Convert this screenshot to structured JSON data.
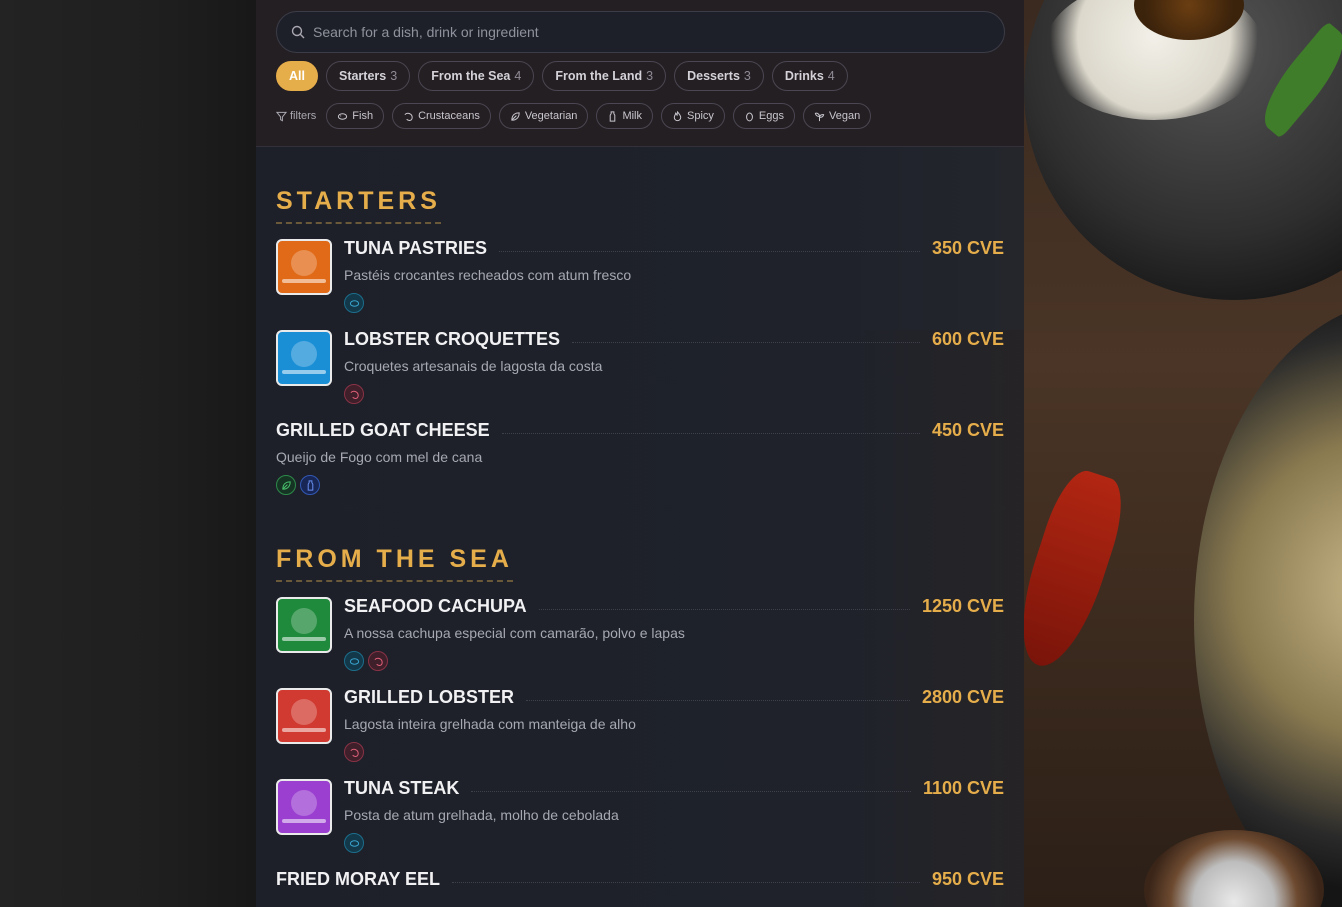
{
  "search": {
    "placeholder": "Search for a dish, drink or ingredient"
  },
  "tabs": [
    {
      "label": "All",
      "count": ""
    },
    {
      "label": "Starters",
      "count": "3"
    },
    {
      "label": "From the Sea",
      "count": "4"
    },
    {
      "label": "From the Land",
      "count": "3"
    },
    {
      "label": "Desserts",
      "count": "3"
    },
    {
      "label": "Drinks",
      "count": "4"
    }
  ],
  "filters": {
    "label": "filters",
    "chips": [
      "Fish",
      "Crustaceans",
      "Vegetarian",
      "Milk",
      "Spicy",
      "Eggs",
      "Vegan"
    ]
  },
  "colors": {
    "accent": "#e6ad4b",
    "panel": "#1f222b",
    "fish": "#1c6e8c",
    "crustaceans": "#8a3246",
    "vegetarian": "#2d8a4a",
    "milk": "#3258b4"
  },
  "sections": [
    {
      "title": "STARTERS",
      "items": [
        {
          "name": "TUNA PASTRIES",
          "price": "350 CVE",
          "desc": "Pastéis crocantes recheados com atum fresco",
          "thumb": "#e06a17",
          "tags": [
            "fish"
          ]
        },
        {
          "name": "LOBSTER CROQUETTES",
          "price": "600 CVE",
          "desc": "Croquetes artesanais de lagosta da costa",
          "thumb": "#1b8fd6",
          "tags": [
            "crustaceans"
          ]
        },
        {
          "name": "GRILLED GOAT CHEESE",
          "price": "450 CVE",
          "desc": "Queijo de Fogo com mel de cana",
          "thumb": "",
          "tags": [
            "vegetarian",
            "milk"
          ]
        }
      ]
    },
    {
      "title": "FROM THE SEA",
      "items": [
        {
          "name": "SEAFOOD CACHUPA",
          "price": "1250 CVE",
          "desc": "A nossa cachupa especial com camarão, polvo e lapas",
          "thumb": "#1f8a3c",
          "tags": [
            "fish",
            "crustaceans"
          ]
        },
        {
          "name": "GRILLED LOBSTER",
          "price": "2800 CVE",
          "desc": "Lagosta inteira grelhada com manteiga de alho",
          "thumb": "#d13a30",
          "tags": [
            "crustaceans"
          ]
        },
        {
          "name": "TUNA STEAK",
          "price": "1100 CVE",
          "desc": "Posta de atum grelhada, molho de cebolada",
          "thumb": "#9a3fd0",
          "tags": [
            "fish"
          ]
        },
        {
          "name": "FRIED MORAY EEL",
          "price": "950 CVE",
          "desc": "",
          "thumb": "",
          "tags": []
        }
      ]
    }
  ]
}
